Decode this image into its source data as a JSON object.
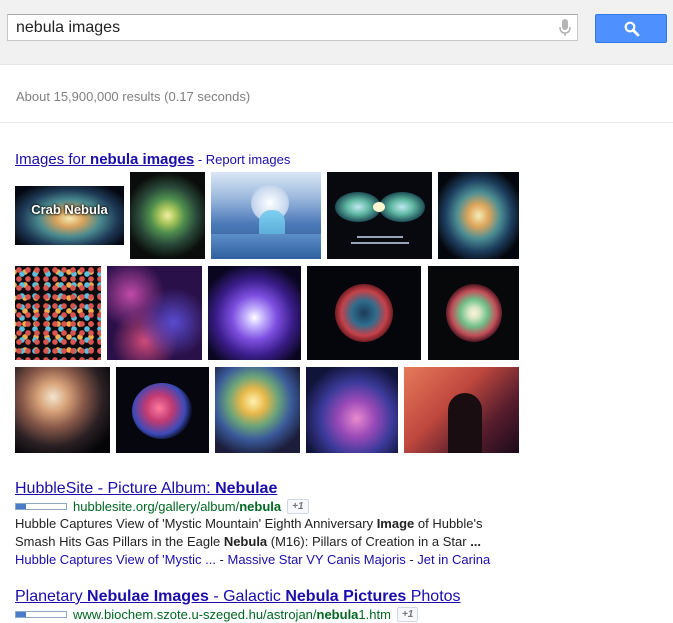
{
  "search": {
    "query": "nebula images"
  },
  "stats": "About 15,900,000 results (0.17 seconds)",
  "images": {
    "head_prefix": "Images for ",
    "head_bold": "nebula images",
    "separator": " - ",
    "report": "Report images",
    "caption_crab": "Crab Nebula"
  },
  "results": [
    {
      "title_pre": "HubbleSite - Picture Album: ",
      "title_bold": "Nebulae",
      "url_pre": "hubblesite.org/gallery/album/",
      "url_bold": "nebula",
      "plus1": "+1",
      "snippet_1a": "Hubble Captures View of 'Mystic Mountain' Eighth Anniversary ",
      "snippet_1b": "Image",
      "snippet_1c": " of Hubble's",
      "snippet_2a": "Smash Hits Gas Pillars in the Eagle ",
      "snippet_2b": "Nebula",
      "snippet_2c": " (M16): Pillars of Creation in a Star ",
      "snippet_2d": "...",
      "sitelink_1": "Hubble Captures View of 'Mystic ...",
      "sitelink_2": "Massive Star VY Canis Majoris",
      "sitelink_3": "Jet in Carina",
      "dash": " - "
    },
    {
      "title_1": "Planetary ",
      "title_2": "Nebulae Images",
      "title_3": " - Galactic ",
      "title_4": "Nebula Pictures",
      "title_5": " Photos",
      "url_pre": "www.biochem.szote.u-szeged.hu/astrojan/",
      "url_bold": "nebula",
      "url_post": "1.htm",
      "plus1": "+1"
    }
  ],
  "colors": {
    "link": "#1a0dab",
    "url": "#006621",
    "search_button": "#4d90fe",
    "stats": "#808080"
  },
  "icons": [
    "microphone-icon",
    "magnifier-icon"
  ]
}
